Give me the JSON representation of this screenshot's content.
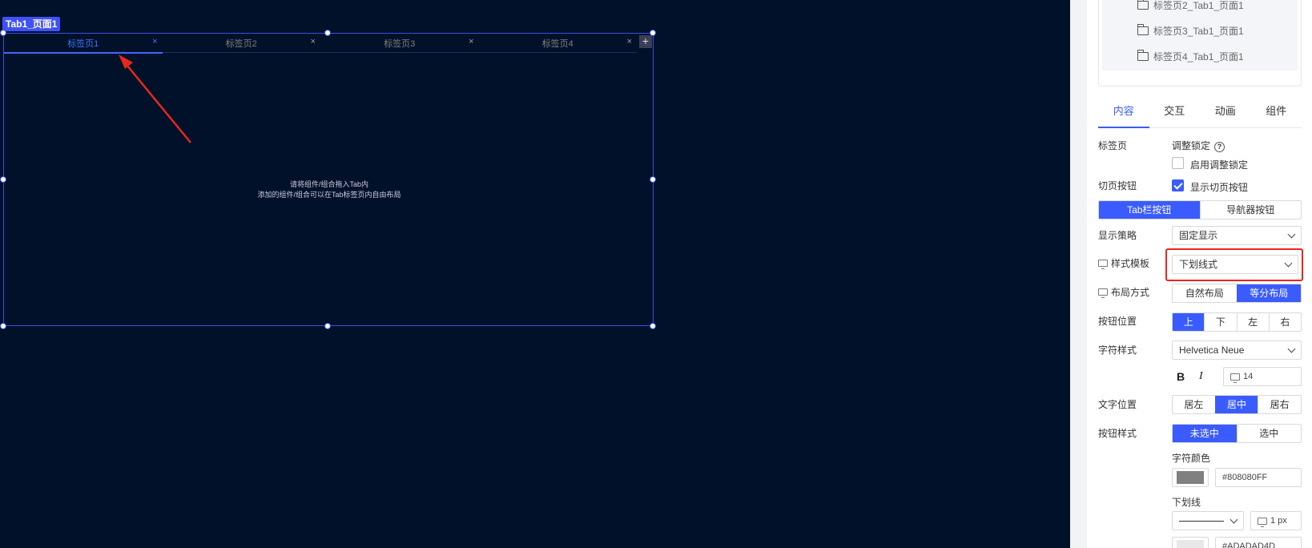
{
  "canvas": {
    "component_tag": "Tab1_页面1",
    "tabs": [
      {
        "label": "标签页1",
        "close": "×",
        "active": true
      },
      {
        "label": "标签页2",
        "close": "×",
        "active": false
      },
      {
        "label": "标签页3",
        "close": "×",
        "active": false
      },
      {
        "label": "标签页4",
        "close": "×",
        "active": false
      }
    ],
    "add_tab_symbol": "+",
    "hint_line1": "请将组件/组合拖入Tab内",
    "hint_line2": "添加的组件/组合可以在Tab标签页内自由布局"
  },
  "layers": {
    "items": [
      "标签页2_Tab1_页面1",
      "标签页3_Tab1_页面1",
      "标签页4_Tab1_页面1"
    ]
  },
  "panel_tabs": [
    "内容",
    "交互",
    "动画",
    "组件"
  ],
  "props": {
    "tab_page_label": "标签页",
    "adjust_lock_label": "调整锁定",
    "help_symbol": "?",
    "enable_lock_label": "启用调整锁定",
    "switch_button_label": "切页按钮",
    "show_switch_label": "显示切页按钮",
    "switch_modes": [
      "Tab栏按钮",
      "导航器按钮"
    ],
    "display_strategy_label": "显示策略",
    "display_strategy_value": "固定显示",
    "style_template_label": "样式模板",
    "style_template_value": "下划线式",
    "layout_label": "布局方式",
    "layout_options": [
      "自然布局",
      "等分布局"
    ],
    "button_position_label": "按钮位置",
    "button_positions": [
      "上",
      "下",
      "左",
      "右"
    ],
    "font_style_label": "字符样式",
    "font_value": "Helvetica Neue",
    "bold_symbol": "B",
    "italic_symbol": "I",
    "font_size": "14",
    "text_position_label": "文字位置",
    "text_positions": [
      "居左",
      "居中",
      "居右"
    ],
    "button_style_label": "按钮样式",
    "button_states": [
      "未选中",
      "选中"
    ],
    "font_color_label": "字符颜色",
    "font_color_value": "#808080FF",
    "underline_label": "下划线",
    "underline_width": "1 px",
    "underline_color_value": "#ADADAD4D"
  },
  "colors": {
    "canvas_bg": "#001129",
    "accent": "#3a5cff",
    "highlight": "#e8271d",
    "font_color_swatch": "#808080",
    "underline_swatch": "#e8e8e8"
  },
  "active_selections": {
    "switch_mode": "Tab栏按钮",
    "layout": "等分布局",
    "button_position": "上",
    "text_position": "居中",
    "button_state": "未选中"
  }
}
